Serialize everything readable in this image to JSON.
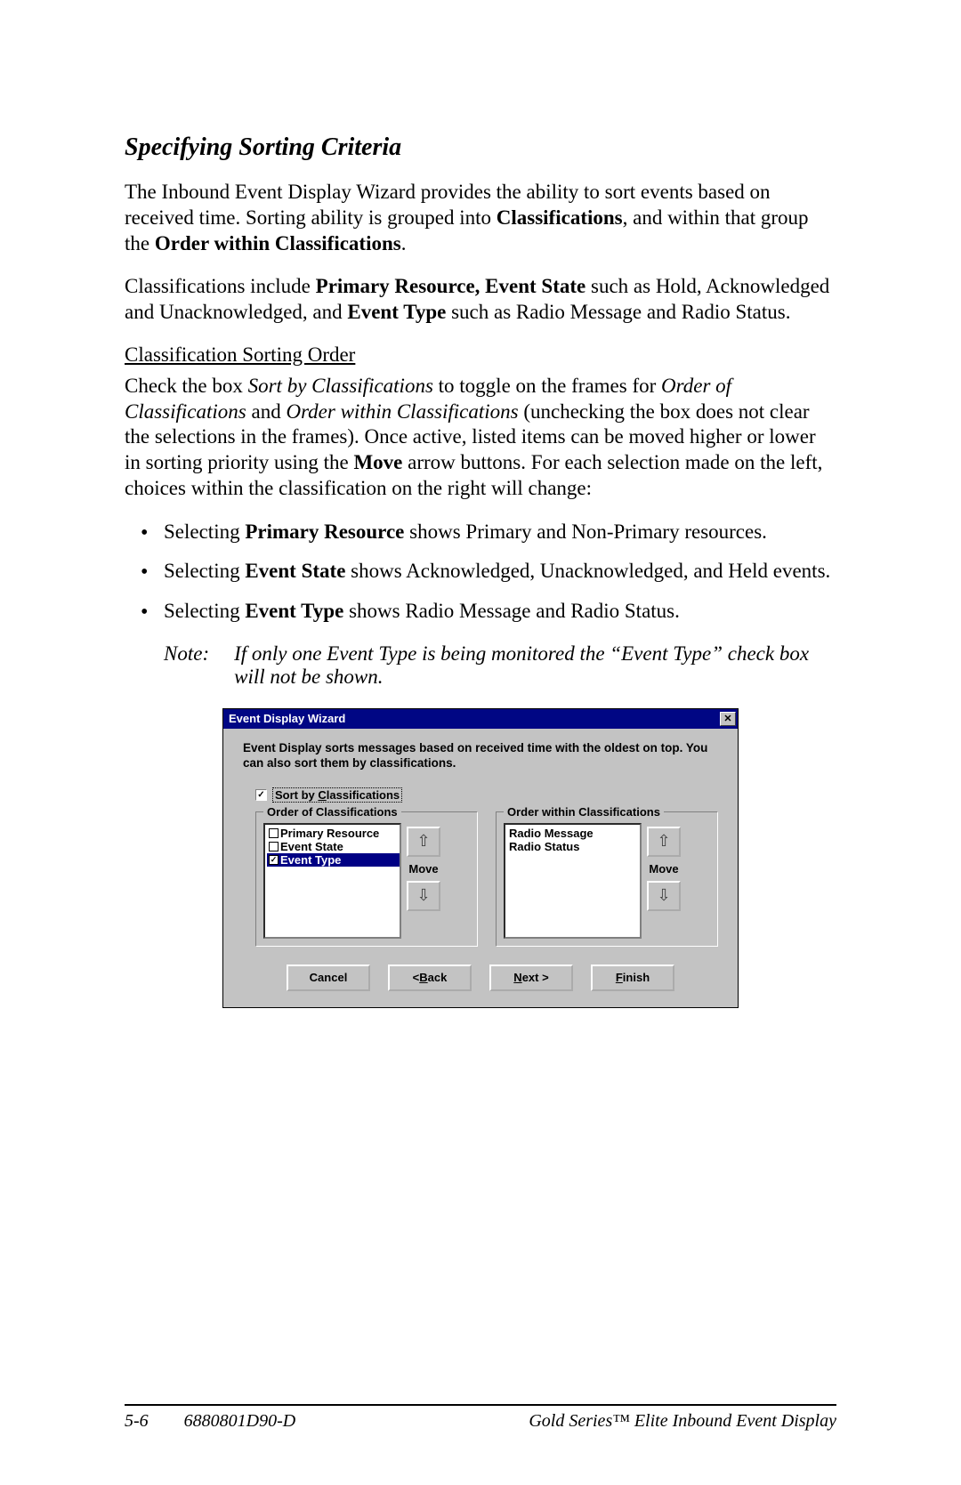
{
  "heading": "Specifying Sorting Criteria",
  "para1_a": "The Inbound Event Display Wizard provides the ability to sort events based on received time.  Sorting ability is grouped into ",
  "para1_b": "Classifications",
  "para1_c": ", and within that group the ",
  "para1_d": "Order within Classifications",
  "para1_e": ".",
  "para2_a": "Classifications include ",
  "para2_b": "Primary Resource, Event State",
  "para2_c": " such as Hold, Acknowledged and Unacknowledged, and ",
  "para2_d": "Event Type",
  "para2_e": " such as Radio Message and Radio Status.",
  "subhead": "Classification Sorting Order",
  "para3_a": "Check the box ",
  "para3_b": "Sort by Classifications",
  "para3_c": " to toggle on the frames for ",
  "para3_d": "Order of Classifications",
  "para3_e": " and ",
  "para3_f": "Order within Classifications",
  "para3_g": " (unchecking the box does not clear the selections in the frames).  Once active, listed items can be moved higher or lower in sorting priority using the ",
  "para3_h": "Move",
  "para3_i": " arrow buttons.  For each selection made on the left, choices within the classification on the right will change:",
  "bullet1_a": "Selecting ",
  "bullet1_b": "Primary Resource",
  "bullet1_c": " shows Primary and Non-Primary resources.",
  "bullet2_a": "Selecting ",
  "bullet2_b": "Event State",
  "bullet2_c": " shows Acknowledged, Unacknowledged, and Held events.",
  "bullet3_a": "Selecting ",
  "bullet3_b": "Event Type",
  "bullet3_c": " shows Radio Message and Radio Status.",
  "note_label": "Note:",
  "note_text": "If only one Event Type is being monitored the “Event Type” check box will not be shown.",
  "wizard": {
    "title": "Event Display Wizard",
    "desc": "Event Display sorts messages based on received time with the oldest on top. You can also sort them by classifications.",
    "checkbox_label_pre": "Sort by ",
    "checkbox_label_u": "C",
    "checkbox_label_post": "lassifications",
    "group1": "Order of Classifications",
    "group2": "Order within Classifications",
    "list1": [
      "Primary Resource",
      "Event State",
      "Event Type"
    ],
    "list1_checked": [
      false,
      false,
      true
    ],
    "list1_selected": 2,
    "list2": [
      "Radio Message",
      "Radio Status"
    ],
    "move": "Move",
    "buttons": {
      "cancel": "Cancel",
      "back_pre": "< ",
      "back_u": "B",
      "back_post": "ack",
      "next_u": "N",
      "next_post": "ext >",
      "finish_u": "F",
      "finish_post": "inish"
    }
  },
  "footer": {
    "page": "5-6",
    "docnum": "6880801D90-D",
    "title": "Gold Series™ Elite Inbound Event Display"
  }
}
